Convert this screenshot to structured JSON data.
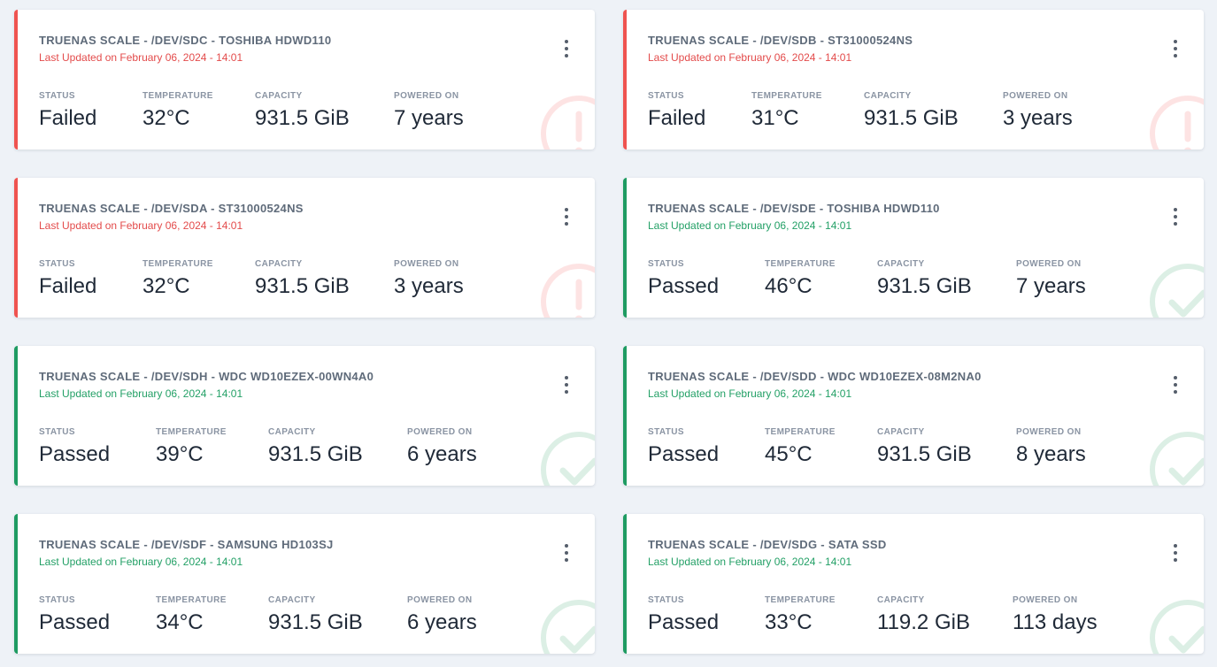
{
  "labels": {
    "status": "STATUS",
    "temperature": "TEMPERATURE",
    "capacity": "CAPACITY",
    "powered_on": "POWERED ON"
  },
  "colors": {
    "failed": "#ef5350",
    "passed": "#1e9b62",
    "background": "#eef2f7"
  },
  "disks": [
    {
      "title": "TRUENAS SCALE - /DEV/SDC - TOSHIBA HDWD110",
      "updated": "Last Updated on February 06, 2024 - 14:01",
      "status": "Failed",
      "temperature": "32°C",
      "capacity": "931.5 GiB",
      "powered_on": "7 years",
      "state_icon": "alert-icon"
    },
    {
      "title": "TRUENAS SCALE - /DEV/SDB - ST31000524NS",
      "updated": "Last Updated on February 06, 2024 - 14:01",
      "status": "Failed",
      "temperature": "31°C",
      "capacity": "931.5 GiB",
      "powered_on": "3 years",
      "state_icon": "alert-icon"
    },
    {
      "title": "TRUENAS SCALE - /DEV/SDA - ST31000524NS",
      "updated": "Last Updated on February 06, 2024 - 14:01",
      "status": "Failed",
      "temperature": "32°C",
      "capacity": "931.5 GiB",
      "powered_on": "3 years",
      "state_icon": "alert-icon"
    },
    {
      "title": "TRUENAS SCALE - /DEV/SDE - TOSHIBA HDWD110",
      "updated": "Last Updated on February 06, 2024 - 14:01",
      "status": "Passed",
      "temperature": "46°C",
      "capacity": "931.5 GiB",
      "powered_on": "7 years",
      "state_icon": "check-icon"
    },
    {
      "title": "TRUENAS SCALE - /DEV/SDH - WDC WD10EZEX-00WN4A0",
      "updated": "Last Updated on February 06, 2024 - 14:01",
      "status": "Passed",
      "temperature": "39°C",
      "capacity": "931.5 GiB",
      "powered_on": "6 years",
      "state_icon": "check-icon"
    },
    {
      "title": "TRUENAS SCALE - /DEV/SDD - WDC WD10EZEX-08M2NA0",
      "updated": "Last Updated on February 06, 2024 - 14:01",
      "status": "Passed",
      "temperature": "45°C",
      "capacity": "931.5 GiB",
      "powered_on": "8 years",
      "state_icon": "check-icon"
    },
    {
      "title": "TRUENAS SCALE - /DEV/SDF - SAMSUNG HD103SJ",
      "updated": "Last Updated on February 06, 2024 - 14:01",
      "status": "Passed",
      "temperature": "34°C",
      "capacity": "931.5 GiB",
      "powered_on": "6 years",
      "state_icon": "check-icon"
    },
    {
      "title": "TRUENAS SCALE - /DEV/SDG - SATA SSD",
      "updated": "Last Updated on February 06, 2024 - 14:01",
      "status": "Passed",
      "temperature": "33°C",
      "capacity": "119.2 GiB",
      "powered_on": "113 days",
      "state_icon": "check-icon"
    }
  ]
}
